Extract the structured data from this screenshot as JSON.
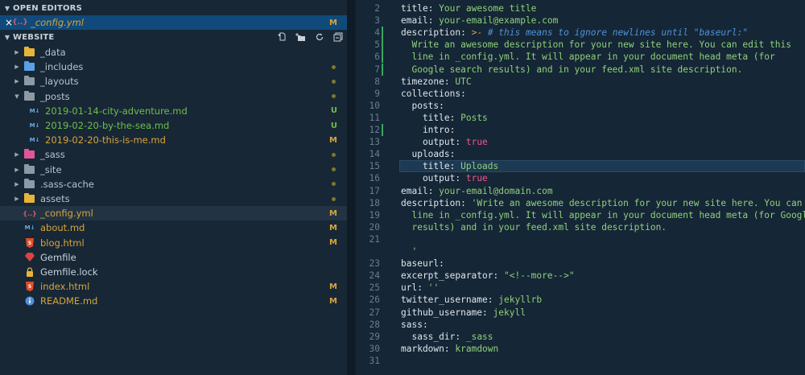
{
  "explorer": {
    "open_editors_title": "OPEN EDITORS",
    "open_editors": [
      {
        "close": "×",
        "icon": "{..}",
        "name": "_config.yml",
        "badge": "M"
      }
    ],
    "website_title": "WEBSITE",
    "toolbar_icons": [
      "new-file-icon",
      "new-folder-icon",
      "refresh-icon",
      "collapse-all-icon"
    ],
    "items": [
      {
        "name": "_data",
        "kind": "folder",
        "state": "collapsed",
        "color": "#e8b33a",
        "status": "",
        "depth": 0
      },
      {
        "name": "_includes",
        "kind": "folder",
        "state": "collapsed",
        "color": "#5aa0e6",
        "status": "dot",
        "depth": 0
      },
      {
        "name": "_layouts",
        "kind": "folder",
        "state": "collapsed",
        "color": "#8c9aa6",
        "status": "dot",
        "depth": 0
      },
      {
        "name": "_posts",
        "kind": "folder",
        "state": "expanded",
        "color": "#8c9aa6",
        "status": "dot",
        "depth": 0
      },
      {
        "name": "2019-01-14-city-adventure.md",
        "kind": "md",
        "status": "U",
        "depth": 1
      },
      {
        "name": "2019-02-20-by-the-sea.md",
        "kind": "md",
        "status": "U",
        "depth": 1
      },
      {
        "name": "2019-02-20-this-is-me.md",
        "kind": "md",
        "status": "M",
        "depth": 1
      },
      {
        "name": "_sass",
        "kind": "folder",
        "state": "collapsed",
        "color": "#e0569a",
        "status": "dot",
        "depth": 0
      },
      {
        "name": "_site",
        "kind": "folder",
        "state": "collapsed",
        "color": "#8c9aa6",
        "status": "dot",
        "depth": 0
      },
      {
        "name": ".sass-cache",
        "kind": "folder",
        "state": "collapsed",
        "color": "#8c9aa6",
        "status": "dot",
        "depth": 0
      },
      {
        "name": "assets",
        "kind": "folder",
        "state": "collapsed",
        "color": "#e8b33a",
        "status": "dot",
        "depth": 0
      },
      {
        "name": "_config.yml",
        "kind": "yml",
        "status": "M",
        "depth": 0
      },
      {
        "name": "about.md",
        "kind": "md",
        "status": "M",
        "depth": 0
      },
      {
        "name": "blog.html",
        "kind": "html",
        "status": "M",
        "depth": 0
      },
      {
        "name": "Gemfile",
        "kind": "gem",
        "status": "",
        "depth": 0
      },
      {
        "name": "Gemfile.lock",
        "kind": "lock",
        "status": "",
        "depth": 0
      },
      {
        "name": "index.html",
        "kind": "html",
        "status": "M",
        "depth": 0
      },
      {
        "name": "README.md",
        "kind": "info",
        "status": "M",
        "depth": 0
      }
    ]
  },
  "editor": {
    "lines": [
      {
        "n": "2",
        "g": false,
        "t": [
          [
            "k",
            "title"
          ],
          [
            "p",
            ": "
          ],
          [
            "s",
            "Your awesome title"
          ]
        ]
      },
      {
        "n": "3",
        "g": false,
        "t": [
          [
            "k",
            "email"
          ],
          [
            "p",
            ": "
          ],
          [
            "s",
            "your-email@example.com"
          ]
        ]
      },
      {
        "n": "4",
        "g": true,
        "t": [
          [
            "k",
            "description"
          ],
          [
            "p",
            ": "
          ],
          [
            "o",
            ">-"
          ],
          [
            "p",
            " "
          ],
          [
            "c",
            "# this means to ignore newlines until \"baseurl:\""
          ]
        ]
      },
      {
        "n": "5",
        "g": true,
        "t": [
          [
            "s",
            "  Write an awesome description for your new site here. You can edit this"
          ]
        ]
      },
      {
        "n": "6",
        "g": true,
        "t": [
          [
            "s",
            "  line in _config.yml. It will appear in your document head meta (for"
          ]
        ]
      },
      {
        "n": "7",
        "g": true,
        "t": [
          [
            "s",
            "  Google search results) and in your feed.xml site description."
          ]
        ]
      },
      {
        "n": "8",
        "g": false,
        "t": [
          [
            "k",
            "timezone"
          ],
          [
            "p",
            ": "
          ],
          [
            "s",
            "UTC"
          ]
        ]
      },
      {
        "n": "9",
        "g": false,
        "t": [
          [
            "k",
            "collections"
          ],
          [
            "p",
            ":"
          ]
        ]
      },
      {
        "n": "10",
        "g": false,
        "t": [
          [
            "k",
            "  posts"
          ],
          [
            "p",
            ":"
          ]
        ]
      },
      {
        "n": "11",
        "g": false,
        "t": [
          [
            "k",
            "    title"
          ],
          [
            "p",
            ": "
          ],
          [
            "s",
            "Posts"
          ]
        ]
      },
      {
        "n": "12",
        "g": true,
        "t": [
          [
            "k",
            "    intro"
          ],
          [
            "p",
            ":"
          ]
        ]
      },
      {
        "n": "13",
        "g": false,
        "t": [
          [
            "k",
            "    output"
          ],
          [
            "p",
            ": "
          ],
          [
            "b",
            "true"
          ]
        ]
      },
      {
        "n": "14",
        "g": false,
        "t": [
          [
            "k",
            "  uploads"
          ],
          [
            "p",
            ":"
          ]
        ]
      },
      {
        "n": "15",
        "g": false,
        "h": true,
        "t": [
          [
            "k",
            "    title"
          ],
          [
            "p",
            ": "
          ],
          [
            "s",
            "Uploads"
          ]
        ]
      },
      {
        "n": "16",
        "g": false,
        "t": [
          [
            "k",
            "    output"
          ],
          [
            "p",
            ": "
          ],
          [
            "b",
            "true"
          ]
        ]
      },
      {
        "n": "17",
        "g": false,
        "t": [
          [
            "k",
            "email"
          ],
          [
            "p",
            ": "
          ],
          [
            "s",
            "your-email@domain.com"
          ]
        ]
      },
      {
        "n": "18",
        "g": false,
        "t": [
          [
            "k",
            "description"
          ],
          [
            "p",
            ": "
          ],
          [
            "s",
            "'Write an awesome description for your new site here. You can edit this"
          ]
        ]
      },
      {
        "n": "19",
        "g": false,
        "t": [
          [
            "s",
            "  line in _config.yml. It will appear in your document head meta (for Google search"
          ]
        ]
      },
      {
        "n": "20",
        "g": false,
        "t": [
          [
            "s",
            "  results) and in your feed.xml site description."
          ]
        ]
      },
      {
        "n": "21",
        "g": false,
        "t": []
      },
      {
        "n": "",
        "g": false,
        "t": [
          [
            "s",
            "  '"
          ]
        ]
      },
      {
        "n": "23",
        "g": false,
        "t": [
          [
            "k",
            "baseurl"
          ],
          [
            "p",
            ":"
          ]
        ]
      },
      {
        "n": "24",
        "g": false,
        "t": [
          [
            "k",
            "excerpt_separator"
          ],
          [
            "p",
            ": "
          ],
          [
            "s",
            "\"<!--more-->\""
          ]
        ]
      },
      {
        "n": "25",
        "g": false,
        "t": [
          [
            "k",
            "url"
          ],
          [
            "p",
            ": "
          ],
          [
            "s",
            "''"
          ]
        ]
      },
      {
        "n": "26",
        "g": false,
        "t": [
          [
            "k",
            "twitter_username"
          ],
          [
            "p",
            ": "
          ],
          [
            "s",
            "jekyllrb"
          ]
        ]
      },
      {
        "n": "27",
        "g": false,
        "t": [
          [
            "k",
            "github_username"
          ],
          [
            "p",
            ": "
          ],
          [
            "s",
            "jekyll"
          ]
        ]
      },
      {
        "n": "28",
        "g": false,
        "t": [
          [
            "k",
            "sass"
          ],
          [
            "p",
            ":"
          ]
        ]
      },
      {
        "n": "29",
        "g": false,
        "t": [
          [
            "k",
            "  sass_dir"
          ],
          [
            "p",
            ": "
          ],
          [
            "s",
            "_sass"
          ]
        ]
      },
      {
        "n": "30",
        "g": false,
        "t": [
          [
            "k",
            "markdown"
          ],
          [
            "p",
            ": "
          ],
          [
            "s",
            "kramdown"
          ]
        ]
      },
      {
        "n": "31",
        "g": false,
        "t": []
      }
    ]
  },
  "colors": {
    "key": "#dfe6ec",
    "string": "#8fd17b",
    "comment": "#4f93d6",
    "operator": "#f0964a",
    "bool": "#f2558c",
    "punct": "#dfe6ec",
    "modified": "#d7a53a",
    "untracked": "#6fbf4a",
    "folder_text": "#b8c4ce",
    "file_text": "#c9d2da"
  }
}
